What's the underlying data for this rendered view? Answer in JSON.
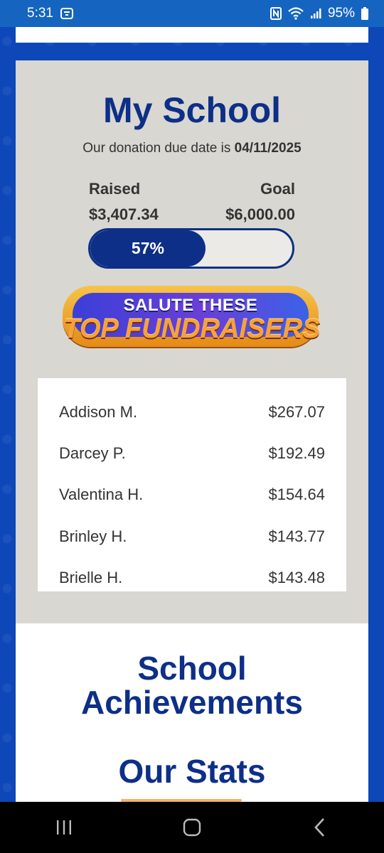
{
  "status_bar": {
    "time": "5:31",
    "battery": "95%",
    "icons": [
      "notification-icon",
      "nfc-icon",
      "wifi-icon",
      "signal-icon",
      "battery-icon"
    ]
  },
  "my_school": {
    "title": "My School",
    "due_prefix": "Our donation due date is ",
    "due_date": "04/11/2025",
    "raised_label": "Raised",
    "goal_label": "Goal",
    "raised_value": "$3,407.34",
    "goal_value": "$6,000.00",
    "progress_text": "57%",
    "progress_fraction": 0.57
  },
  "banner": {
    "line1": "SALUTE THESE",
    "line2": "TOP FUNDRAISERS"
  },
  "top_fundraisers": [
    {
      "name": "Addison M.",
      "amount": "$267.07"
    },
    {
      "name": "Darcey P.",
      "amount": "$192.49"
    },
    {
      "name": "Valentina H.",
      "amount": "$154.64"
    },
    {
      "name": "Brinley H.",
      "amount": "$143.77"
    },
    {
      "name": "Brielle H.",
      "amount": "$143.48"
    }
  ],
  "sections": {
    "achievements_title": "School Achievements",
    "stats_title": "Our Stats"
  },
  "colors": {
    "brand_navy": "#0d2f87",
    "page_blue": "#0d47b8",
    "card_gray": "#d9d7d1"
  }
}
